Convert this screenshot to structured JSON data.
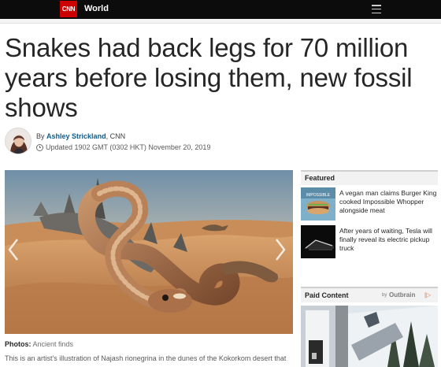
{
  "topbar": {
    "logo_text": "CNN",
    "section": "World",
    "menu_icon": "hamburger-menu-icon",
    "brand_color": "#cc0000"
  },
  "article": {
    "headline": "Snakes had back legs for 70 million years before losing them, new fossil shows",
    "byline_prefix": "By",
    "author": "Ashley Strickland",
    "source": ", CNN",
    "timestamp": "Updated 1902 GMT (0302 HKT) November 20, 2019",
    "photo_label": "Photos:",
    "photo_source": "Ancient finds",
    "caption": "This is an artist's illustration of Najash rionegrina in the dunes of the Kokorkom desert that"
  },
  "sidebar": {
    "featured_title": "Featured",
    "featured_items": [
      {
        "text": "A vegan man claims Burger King cooked Impossible Whopper alongside meat",
        "thumb": "burger-thumbnail"
      },
      {
        "text": "After years of waiting, Tesla will finally reveal its electric pickup truck",
        "thumb": "tesla-truck-thumbnail"
      }
    ],
    "paid_title": "Paid Content",
    "paid_by": "by",
    "outbrain": "Outbrain",
    "outbrain_mark": "|▷"
  }
}
